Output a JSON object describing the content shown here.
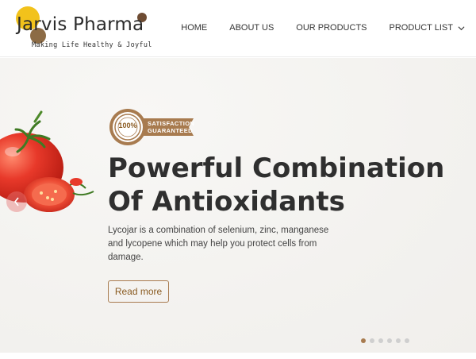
{
  "brand": {
    "name": "Jarvis Pharma",
    "tagline": "Making Life Healthy & Joyful"
  },
  "nav": {
    "items": [
      {
        "label": "HOME"
      },
      {
        "label": "ABOUT US"
      },
      {
        "label": "OUR PRODUCTS"
      },
      {
        "label": "PRODUCT LIST"
      }
    ]
  },
  "hero": {
    "badge": {
      "number": "100%",
      "line1": "SATISFACTION",
      "line2": "GUARANTEED"
    },
    "headline": "Powerful Combination Of Antioxidants",
    "description": "Lycojar is a combination of selenium, zinc, manganese and lycopene which may help you protect cells from damage.",
    "button_label": "Read more",
    "slides_total": 6,
    "slide_active": 1
  },
  "colors": {
    "accent": "#a87b4f",
    "logo_yellow": "#f2c21b",
    "logo_brown": "#8c6b45",
    "tomato_red": "#e53d2a"
  },
  "icons": {
    "prev": "chevron-left-icon",
    "dropdown": "chevron-down-icon"
  }
}
